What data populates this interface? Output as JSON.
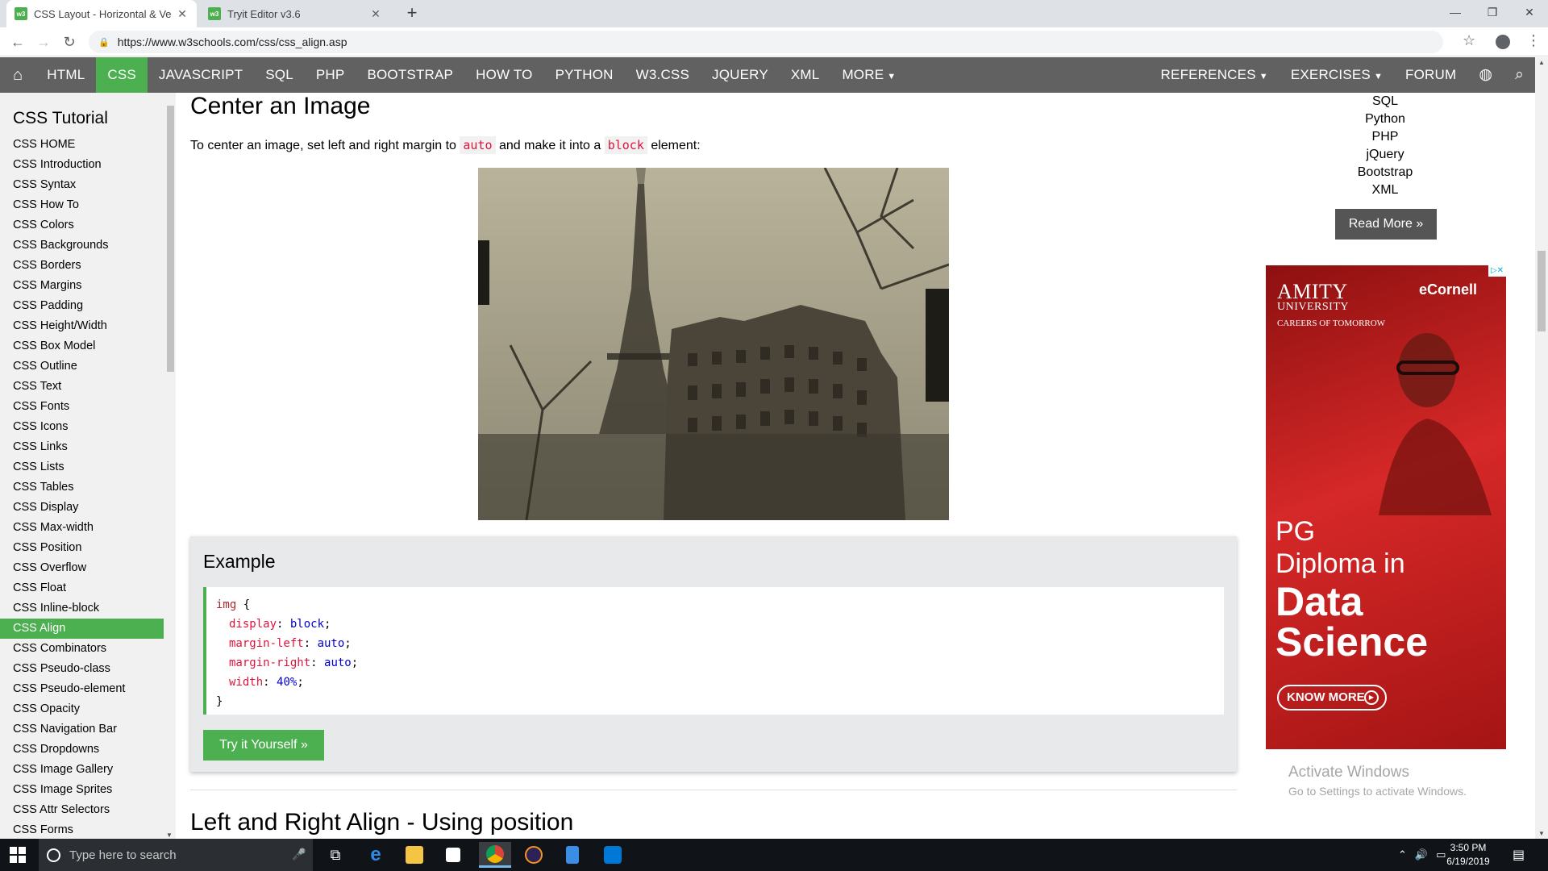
{
  "browser": {
    "tabs": [
      {
        "title": "CSS Layout - Horizontal & Vertic",
        "active": true
      },
      {
        "title": "Tryit Editor v3.6",
        "active": false
      }
    ],
    "url": "https://www.w3schools.com/css/css_align.asp"
  },
  "topnav": {
    "items": [
      "HTML",
      "CSS",
      "JAVASCRIPT",
      "SQL",
      "PHP",
      "BOOTSTRAP",
      "HOW TO",
      "PYTHON",
      "W3.CSS",
      "JQUERY",
      "XML",
      "MORE"
    ],
    "active": "CSS",
    "right_items": [
      "REFERENCES",
      "EXERCISES",
      "FORUM"
    ]
  },
  "sidebar": {
    "title": "CSS Tutorial",
    "items": [
      "CSS HOME",
      "CSS Introduction",
      "CSS Syntax",
      "CSS How To",
      "CSS Colors",
      "CSS Backgrounds",
      "CSS Borders",
      "CSS Margins",
      "CSS Padding",
      "CSS Height/Width",
      "CSS Box Model",
      "CSS Outline",
      "CSS Text",
      "CSS Fonts",
      "CSS Icons",
      "CSS Links",
      "CSS Lists",
      "CSS Tables",
      "CSS Display",
      "CSS Max-width",
      "CSS Position",
      "CSS Overflow",
      "CSS Float",
      "CSS Inline-block",
      "CSS Align",
      "CSS Combinators",
      "CSS Pseudo-class",
      "CSS Pseudo-element",
      "CSS Opacity",
      "CSS Navigation Bar",
      "CSS Dropdowns",
      "CSS Image Gallery",
      "CSS Image Sprites",
      "CSS Attr Selectors",
      "CSS Forms"
    ],
    "active": "CSS Align"
  },
  "main": {
    "heading": "Center an Image",
    "intro_before": "To center an image, set left and right margin to ",
    "intro_code1": "auto",
    "intro_mid": " and make it into a ",
    "intro_code2": "block",
    "intro_after": " element:",
    "example_title": "Example",
    "code": {
      "selector": "img",
      "open": " {",
      "close": "}",
      "lines": [
        {
          "prop": "display",
          "val": "block"
        },
        {
          "prop": "margin-left",
          "val": "auto"
        },
        {
          "prop": "margin-right",
          "val": "auto"
        },
        {
          "prop": "width",
          "val": "40%"
        }
      ]
    },
    "try_button": "Try it Yourself »",
    "next_heading": "Left and Right Align - Using position"
  },
  "right": {
    "links": [
      "SQL",
      "Python",
      "PHP",
      "jQuery",
      "Bootstrap",
      "XML"
    ],
    "read_more": "Read More »",
    "ad": {
      "brand1": "AMITY",
      "brand1_sub": "UNIVERSITY",
      "tagline": "CAREERS OF TOMORROW",
      "brand2": "eCornell",
      "line1": "PG",
      "line2": "Diploma in",
      "line3": "Data",
      "line4": "Science",
      "button": "KNOW MORE"
    },
    "watermark_title": "Activate Windows",
    "watermark_sub": "Go to Settings to activate Windows."
  },
  "taskbar": {
    "search_placeholder": "Type here to search",
    "time": "3:50 PM",
    "date": "6/19/2019"
  },
  "colors": {
    "accent": "#4CAF50",
    "nav": "#616161",
    "code_prop": "#dc143c",
    "code_val": "#0000cd"
  }
}
